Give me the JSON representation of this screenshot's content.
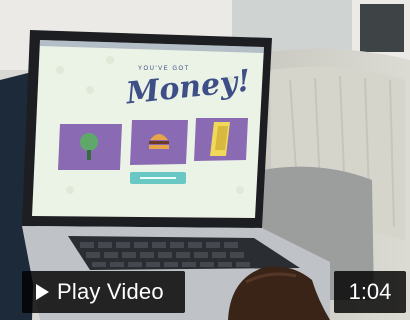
{
  "thumbnail": {
    "screen": {
      "kicker": "YOU'VE GOT",
      "title": "Money!",
      "button_label": "",
      "accent_color": "#3d4f86",
      "panel_color": "#8a6bb3",
      "button_color": "#69c8c4"
    }
  },
  "controls": {
    "play_label": "Play Video",
    "duration": "1:04"
  }
}
